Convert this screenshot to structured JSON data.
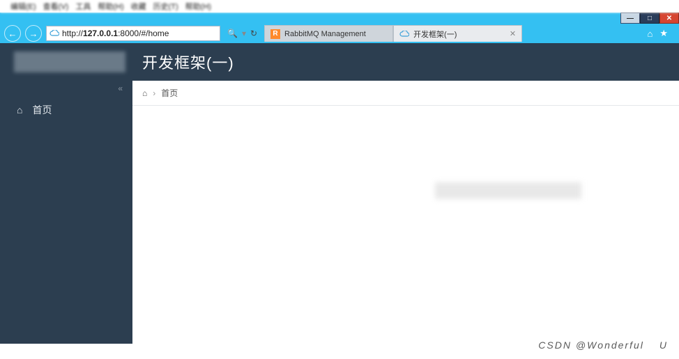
{
  "menubar": {
    "items": [
      "编辑(E)",
      "查看(V)",
      "工具",
      "帮助(H)",
      "收藏",
      "历史(T)",
      "帮助(H)"
    ]
  },
  "titlebar": {
    "minimize": "—",
    "maximize": "□",
    "close": "✕"
  },
  "toolbar": {
    "back": "←",
    "forward": "→",
    "url_prefix": "http://",
    "url_host": "127.0.0.1",
    "url_rest": ":8000/#/home",
    "search_glyph": "🔍",
    "separator": "▾",
    "refresh_glyph": "↻"
  },
  "tabs": {
    "items": [
      {
        "icon": "rabbitmq-icon",
        "icon_text": "R",
        "label": "RabbitMQ Management",
        "active": false,
        "closable": false
      },
      {
        "icon": "cloud-icon",
        "icon_text": "",
        "label": "开发框架(一)",
        "active": true,
        "closable": true
      }
    ],
    "close_glyph": "✕"
  },
  "win_icons": {
    "home": "⌂",
    "star": "★"
  },
  "app": {
    "title": "开发框架(一)",
    "sidebar": {
      "collapse_glyph": "«",
      "items": [
        {
          "icon": "home-icon",
          "icon_glyph": "⌂",
          "label": "首页"
        }
      ]
    },
    "breadcrumb": {
      "home_glyph": "⌂",
      "sep": "›",
      "current": "首页"
    }
  },
  "watermark": {
    "text": "CSDN @Wonderful",
    "tail": "U"
  }
}
